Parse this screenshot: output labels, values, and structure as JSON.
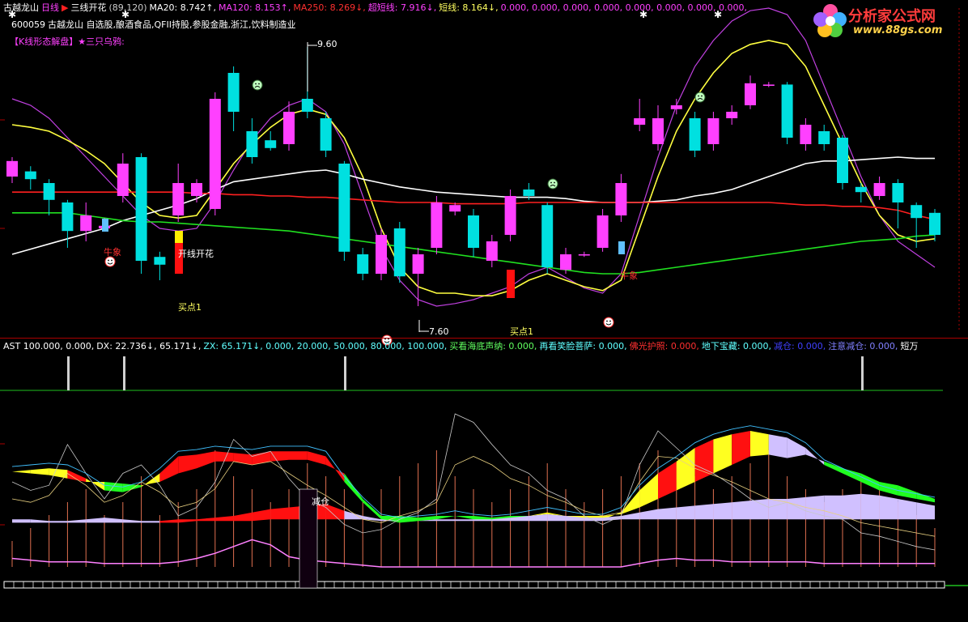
{
  "header": {
    "stock_name": "古越龙山",
    "period": "日线",
    "indicator": "三线开花",
    "indicator_params": "(89,120)",
    "ma20": "MA20: 8.742↑,",
    "ma120": "MA120: 8.153↑,",
    "ma250": "MA250: 8.269↓,",
    "super_short": "超短线: 7.916↓,",
    "short_line": "短线: 8.164↓,",
    "zeros": "0.000, 0.000, 0.000, 0.000, 0.000, 0.000, 0.000, 0.000,",
    "code": "600059",
    "concepts": "古越龙山  自选股,酿酒食品,QFII持股,参股金融,浙江,饮料制造业",
    "pattern_label": "【K线形态解盘】★三只乌鸦:"
  },
  "logo": {
    "title": "分析家公式网",
    "url": "www.88gs.com"
  },
  "annotations": {
    "high_price": "9.60",
    "low_price": "7.60",
    "bull1": "牛象",
    "bull2": "牛象",
    "flower": "开线开花",
    "buy1": "买点1",
    "buy2": "买点1"
  },
  "sub_header": {
    "ast": "AST 100.000, 0.000,",
    "dx": "DX: 22.736↓, 65.171↓,",
    "zx": "ZX: 65.171↓, 0.000, 20.000, 50.000, 80.000, 100.000,",
    "haidi": "买看海底声纳: 0.000,",
    "xiaolian": "再看笑脸菩萨: 0.000,",
    "foguang": "佛光护照: 0.000,",
    "dixia": "地下宝藏: 0.000,",
    "jiancang": "减仓: 0.000,",
    "zhuyi": "注意减仓: 0.000,",
    "duan": "短万"
  },
  "sub_annotation": "减仓",
  "colors": {
    "bull": "#ff40ff",
    "bear": "#00e0e0",
    "ma_white": "#ffffff",
    "ma_red": "#ff2020",
    "ma_green": "#20e020",
    "ma_yellow": "#ffff40",
    "ma_purple": "#c040e0"
  },
  "candles": [
    {
      "o": 8.6,
      "c": 8.72,
      "h": 8.75,
      "l": 8.55
    },
    {
      "o": 8.64,
      "c": 8.58,
      "h": 8.68,
      "l": 8.5
    },
    {
      "o": 8.55,
      "c": 8.42,
      "h": 8.58,
      "l": 8.3
    },
    {
      "o": 8.4,
      "c": 8.18,
      "h": 8.42,
      "l": 8.05
    },
    {
      "o": 8.18,
      "c": 8.3,
      "h": 8.4,
      "l": 8.1
    },
    {
      "o": 8.2,
      "c": 8.22,
      "h": 8.28,
      "l": 8.18
    },
    {
      "o": 8.45,
      "c": 8.7,
      "h": 8.78,
      "l": 8.4
    },
    {
      "o": 8.75,
      "c": 7.95,
      "h": 8.78,
      "l": 7.85
    },
    {
      "o": 7.98,
      "c": 7.92,
      "h": 8.02,
      "l": 7.8
    },
    {
      "o": 8.3,
      "c": 8.55,
      "h": 8.7,
      "l": 8.25
    },
    {
      "o": 8.45,
      "c": 8.55,
      "h": 8.58,
      "l": 8.4
    },
    {
      "o": 8.35,
      "c": 9.2,
      "h": 9.25,
      "l": 8.3
    },
    {
      "o": 9.4,
      "c": 9.1,
      "h": 9.45,
      "l": 8.95
    },
    {
      "o": 8.95,
      "c": 8.75,
      "h": 9.05,
      "l": 8.7
    },
    {
      "o": 8.88,
      "c": 8.82,
      "h": 8.95,
      "l": 8.8
    },
    {
      "o": 8.85,
      "c": 9.1,
      "h": 9.18,
      "l": 8.8
    },
    {
      "o": 9.2,
      "c": 9.1,
      "h": 9.6,
      "l": 9.05
    },
    {
      "o": 9.05,
      "c": 8.8,
      "h": 9.1,
      "l": 8.75
    },
    {
      "o": 8.7,
      "c": 8.02,
      "h": 8.72,
      "l": 7.95
    },
    {
      "o": 8.0,
      "c": 7.85,
      "h": 8.05,
      "l": 7.8
    },
    {
      "o": 7.85,
      "c": 8.15,
      "h": 8.2,
      "l": 7.8
    },
    {
      "o": 8.2,
      "c": 7.83,
      "h": 8.25,
      "l": 7.78
    },
    {
      "o": 7.85,
      "c": 8.0,
      "h": 8.05,
      "l": 7.6
    },
    {
      "o": 8.05,
      "c": 8.4,
      "h": 8.45,
      "l": 8.0
    },
    {
      "o": 8.33,
      "c": 8.38,
      "h": 8.4,
      "l": 8.3
    },
    {
      "o": 8.3,
      "c": 8.05,
      "h": 8.35,
      "l": 7.98
    },
    {
      "o": 7.95,
      "c": 8.1,
      "h": 8.15,
      "l": 7.9
    },
    {
      "o": 8.15,
      "c": 8.45,
      "h": 8.5,
      "l": 8.1
    },
    {
      "o": 8.5,
      "c": 8.45,
      "h": 8.55,
      "l": 8.42
    },
    {
      "o": 8.38,
      "c": 7.9,
      "h": 8.4,
      "l": 7.85
    },
    {
      "o": 7.88,
      "c": 8.0,
      "h": 8.05,
      "l": 7.85
    },
    {
      "o": 8.0,
      "c": 8.0,
      "h": 8.02,
      "l": 7.98
    },
    {
      "o": 8.05,
      "c": 8.3,
      "h": 8.35,
      "l": 8.02
    },
    {
      "o": 8.3,
      "c": 8.55,
      "h": 8.62,
      "l": 8.25
    },
    {
      "o": 9.0,
      "c": 9.05,
      "h": 9.2,
      "l": 8.95
    },
    {
      "o": 8.85,
      "c": 9.05,
      "h": 9.15,
      "l": 8.8
    },
    {
      "o": 9.12,
      "c": 9.15,
      "h": 9.2,
      "l": 9.08
    },
    {
      "o": 9.05,
      "c": 8.8,
      "h": 9.1,
      "l": 8.75
    },
    {
      "o": 8.85,
      "c": 9.05,
      "h": 9.1,
      "l": 8.8
    },
    {
      "o": 9.05,
      "c": 9.1,
      "h": 9.15,
      "l": 9.0
    },
    {
      "o": 9.15,
      "c": 9.32,
      "h": 9.38,
      "l": 9.12
    },
    {
      "o": 9.3,
      "c": 9.31,
      "h": 9.33,
      "l": 9.29
    },
    {
      "o": 9.31,
      "c": 8.9,
      "h": 9.33,
      "l": 8.85
    },
    {
      "o": 8.85,
      "c": 9.0,
      "h": 9.05,
      "l": 8.8
    },
    {
      "o": 8.95,
      "c": 8.85,
      "h": 9.0,
      "l": 8.8
    },
    {
      "o": 8.9,
      "c": 8.55,
      "h": 8.92,
      "l": 8.5
    },
    {
      "o": 8.52,
      "c": 8.48,
      "h": 8.55,
      "l": 8.4
    },
    {
      "o": 8.45,
      "c": 8.55,
      "h": 8.6,
      "l": 8.42
    },
    {
      "o": 8.55,
      "c": 8.4,
      "h": 8.58,
      "l": 8.2
    },
    {
      "o": 8.38,
      "c": 8.28,
      "h": 8.4,
      "l": 8.05
    },
    {
      "o": 8.32,
      "c": 8.15,
      "h": 8.35,
      "l": 8.1
    }
  ],
  "series": {
    "ma_white": [
      8.0,
      8.04,
      8.08,
      8.12,
      8.16,
      8.2,
      8.26,
      8.3,
      8.34,
      8.38,
      8.43,
      8.5,
      8.56,
      8.58,
      8.6,
      8.62,
      8.64,
      8.65,
      8.62,
      8.58,
      8.55,
      8.52,
      8.5,
      8.48,
      8.47,
      8.46,
      8.45,
      8.44,
      8.44,
      8.44,
      8.43,
      8.41,
      8.4,
      8.4,
      8.4,
      8.41,
      8.42,
      8.45,
      8.47,
      8.5,
      8.55,
      8.6,
      8.65,
      8.7,
      8.72,
      8.72,
      8.73,
      8.74,
      8.75,
      8.74,
      8.74
    ],
    "ma_red": [
      8.48,
      8.48,
      8.48,
      8.48,
      8.48,
      8.48,
      8.48,
      8.48,
      8.48,
      8.48,
      8.47,
      8.47,
      8.46,
      8.46,
      8.45,
      8.45,
      8.44,
      8.44,
      8.43,
      8.42,
      8.41,
      8.4,
      8.4,
      8.4,
      8.39,
      8.39,
      8.39,
      8.39,
      8.4,
      8.4,
      8.4,
      8.4,
      8.4,
      8.4,
      8.4,
      8.4,
      8.4,
      8.4,
      8.4,
      8.4,
      8.4,
      8.4,
      8.39,
      8.38,
      8.38,
      8.37,
      8.37,
      8.36,
      8.34,
      8.3,
      8.27
    ],
    "ma_green": [
      8.32,
      8.32,
      8.32,
      8.32,
      8.3,
      8.28,
      8.26,
      8.25,
      8.25,
      8.24,
      8.23,
      8.22,
      8.21,
      8.2,
      8.19,
      8.18,
      8.16,
      8.14,
      8.12,
      8.1,
      8.08,
      8.06,
      8.04,
      8.02,
      8.0,
      7.98,
      7.96,
      7.94,
      7.92,
      7.9,
      7.88,
      7.86,
      7.85,
      7.85,
      7.86,
      7.88,
      7.9,
      7.92,
      7.94,
      7.96,
      7.98,
      8.0,
      8.02,
      8.04,
      8.06,
      8.08,
      8.1,
      8.11,
      8.12,
      8.14,
      8.15
    ],
    "ma_yellow": [
      9.0,
      8.98,
      8.95,
      8.88,
      8.8,
      8.7,
      8.55,
      8.4,
      8.3,
      8.28,
      8.3,
      8.5,
      8.7,
      8.85,
      8.98,
      9.08,
      9.12,
      9.08,
      8.9,
      8.6,
      8.2,
      7.9,
      7.75,
      7.7,
      7.7,
      7.68,
      7.68,
      7.72,
      7.8,
      7.85,
      7.8,
      7.75,
      7.72,
      7.8,
      8.2,
      8.6,
      8.95,
      9.2,
      9.4,
      9.55,
      9.62,
      9.65,
      9.62,
      9.45,
      9.15,
      8.85,
      8.55,
      8.3,
      8.15,
      8.1,
      8.12
    ],
    "ma_purple": [
      9.2,
      9.15,
      9.05,
      8.9,
      8.75,
      8.6,
      8.45,
      8.3,
      8.2,
      8.18,
      8.2,
      8.4,
      8.65,
      8.88,
      9.05,
      9.15,
      9.2,
      9.1,
      8.85,
      8.45,
      8.05,
      7.8,
      7.65,
      7.6,
      7.62,
      7.65,
      7.7,
      7.75,
      7.85,
      7.9,
      7.82,
      7.74,
      7.7,
      7.85,
      8.3,
      8.75,
      9.15,
      9.45,
      9.65,
      9.8,
      9.88,
      9.9,
      9.85,
      9.65,
      9.3,
      8.95,
      8.6,
      8.3,
      8.1,
      8.0,
      7.9
    ]
  },
  "sub": {
    "cloud_upper": [
      56,
      57,
      58,
      57,
      52,
      45,
      44,
      47,
      55,
      65,
      66,
      68,
      67,
      66,
      68,
      68,
      68,
      65,
      50,
      38,
      28,
      26,
      27,
      28,
      30,
      28,
      27,
      28,
      30,
      32,
      30,
      28,
      28,
      32,
      45,
      55,
      62,
      70,
      75,
      78,
      80,
      78,
      76,
      70,
      60,
      55,
      50,
      45,
      42,
      40,
      38
    ],
    "cloud_lower": [
      56,
      55,
      54,
      52,
      50,
      50,
      49,
      48,
      50,
      55,
      58,
      62,
      62,
      60,
      62,
      63,
      63,
      60,
      55,
      40,
      30,
      30,
      29,
      30,
      30,
      30,
      29,
      30,
      30,
      31,
      30,
      30,
      30,
      31,
      35,
      40,
      45,
      50,
      55,
      60,
      65,
      66,
      64,
      66,
      62,
      58,
      55,
      50,
      48,
      44,
      40
    ],
    "low_band_up": [
      28,
      28,
      27,
      27,
      28,
      29,
      28,
      27,
      27,
      28,
      28,
      29,
      30,
      32,
      34,
      35,
      36,
      37,
      33,
      30,
      28,
      27,
      27,
      28,
      28,
      28,
      28,
      29,
      30,
      31,
      30,
      29,
      29,
      30,
      32,
      34,
      35,
      36,
      37,
      38,
      39,
      40,
      40,
      41,
      42,
      42,
      43,
      42,
      40,
      38,
      36
    ],
    "low_band_dn": [
      26,
      26,
      26,
      26,
      26,
      26,
      26,
      26,
      26,
      26,
      27,
      27,
      27,
      27,
      28,
      28,
      28,
      28,
      28,
      28,
      27,
      27,
      27,
      27,
      27,
      27,
      27,
      27,
      27,
      27,
      27,
      27,
      27,
      28,
      28,
      28,
      28,
      28,
      28,
      28,
      28,
      28,
      28,
      28,
      28,
      28,
      28,
      28,
      28,
      28,
      28
    ],
    "pink_line": [
      5,
      4,
      3,
      3,
      3,
      2,
      2,
      2,
      2,
      3,
      5,
      8,
      12,
      16,
      13,
      6,
      4,
      3,
      2,
      1,
      0,
      0,
      0,
      0,
      0,
      0,
      0,
      0,
      0,
      0,
      0,
      0,
      0,
      0,
      2,
      4,
      5,
      4,
      4,
      3,
      3,
      3,
      3,
      3,
      2,
      2,
      2,
      2,
      2,
      2,
      2
    ],
    "thin_a": [
      50,
      45,
      48,
      72,
      55,
      40,
      55,
      60,
      48,
      30,
      35,
      50,
      75,
      65,
      68,
      52,
      40,
      35,
      25,
      20,
      22,
      28,
      32,
      40,
      90,
      85,
      72,
      60,
      55,
      45,
      40,
      30,
      25,
      30,
      60,
      80,
      70,
      60,
      55,
      48,
      40,
      35,
      38,
      33,
      30,
      28,
      20,
      18,
      15,
      12,
      10
    ],
    "thin_b": [
      40,
      38,
      42,
      55,
      48,
      38,
      42,
      50,
      44,
      35,
      38,
      46,
      62,
      60,
      62,
      55,
      48,
      42,
      35,
      28,
      26,
      30,
      33,
      38,
      60,
      65,
      60,
      52,
      48,
      42,
      38,
      33,
      30,
      32,
      50,
      65,
      64,
      58,
      54,
      50,
      45,
      40,
      38,
      35,
      33,
      30,
      26,
      24,
      22,
      20,
      18
    ],
    "vol": [
      0.2,
      0.3,
      0.4,
      0.5,
      0.6,
      0.4,
      0.5,
      0.7,
      0.4,
      0.5,
      0.6,
      0.9,
      0.7,
      0.6,
      0.5,
      0.6,
      0.8,
      0.7,
      0.6,
      0.5,
      0.6,
      0.7,
      0.8,
      0.9,
      0.7,
      0.6,
      0.5,
      0.6,
      0.7,
      0.8,
      0.6,
      0.5,
      0.6,
      0.7,
      0.8,
      0.9,
      0.8,
      0.7,
      0.6,
      0.7,
      0.8,
      0.9,
      0.7,
      0.6,
      0.5,
      0.6,
      0.7,
      0.6,
      0.5,
      0.4,
      0.3
    ]
  }
}
